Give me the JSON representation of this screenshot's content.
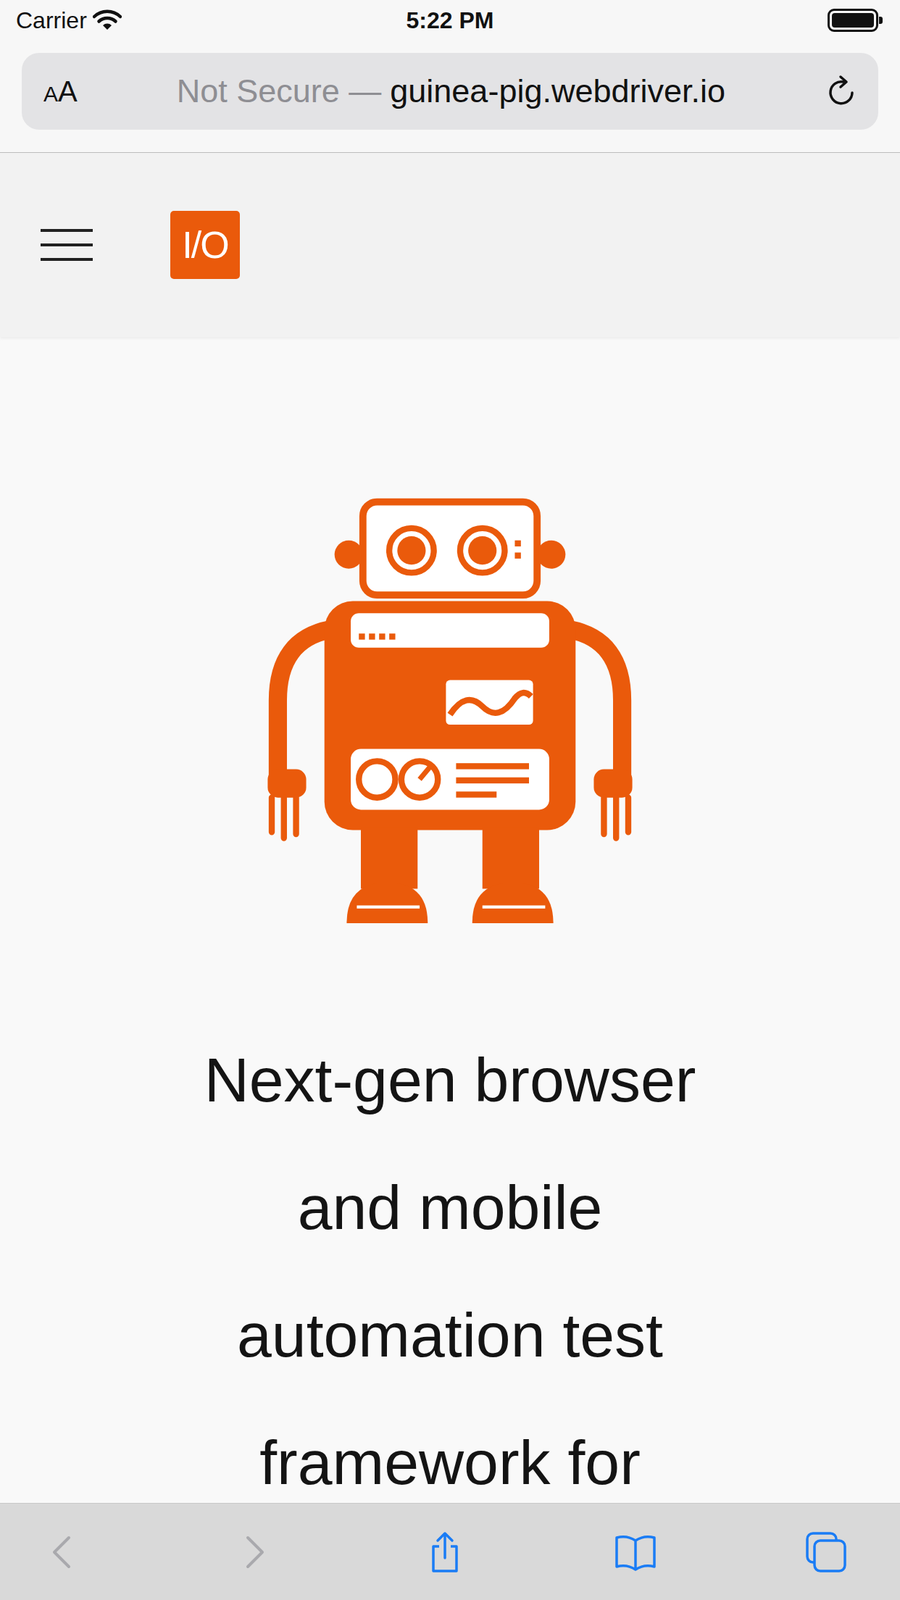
{
  "status_bar": {
    "carrier": "Carrier",
    "time": "5:22 PM",
    "battery_level": 1
  },
  "address_bar": {
    "text_size_button": {
      "small": "A",
      "large": "A"
    },
    "security": "Not Secure —",
    "host": "guinea-pig.webdriver.io"
  },
  "site_header": {
    "logo": "I/O"
  },
  "hero": {
    "heading_lines": [
      "Next-gen browser",
      "and mobile",
      "automation test",
      "framework for"
    ]
  },
  "toolbar": {
    "buttons": [
      {
        "kind": "back",
        "disabled": true
      },
      {
        "kind": "forward",
        "disabled": true
      },
      {
        "kind": "share",
        "disabled": false
      },
      {
        "kind": "bookmarks",
        "disabled": false
      },
      {
        "kind": "tabs",
        "disabled": false
      }
    ]
  }
}
